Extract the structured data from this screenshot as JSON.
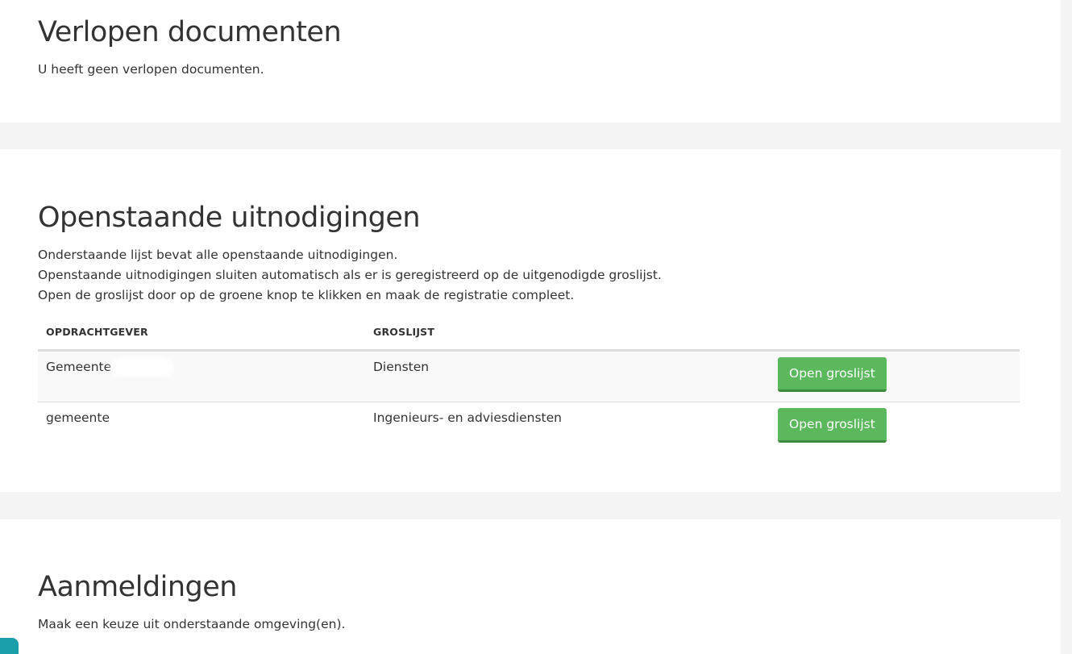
{
  "expired": {
    "title": "Verlopen documenten",
    "text": "U heeft geen verlopen documenten."
  },
  "invites": {
    "title": "Openstaande uitnodigingen",
    "intro": [
      "Onderstaande lijst bevat alle openstaande uitnodigingen.",
      "Openstaande uitnodigingen sluiten automatisch als er is geregistreerd op de uitgenodigde groslijst.",
      "Open de groslijst door op de groene knop te klikken en maak de registratie compleet."
    ],
    "columns": {
      "client": "OPDRACHTGEVER",
      "list": "GROSLIJST"
    },
    "rows": [
      {
        "client": "Gemeente",
        "list": "Diensten",
        "button": "Open groslijst"
      },
      {
        "client": "gemeente",
        "list": "Ingenieurs- en adviesdiensten",
        "button": "Open groslijst"
      }
    ]
  },
  "signups": {
    "title": "Aanmeldingen",
    "text": "Maak een keuze uit onderstaande omgeving(en)."
  },
  "colors": {
    "button": "#5cb85c",
    "button_border": "#3d8b3d",
    "chat_tab": "#1a9fa8"
  }
}
